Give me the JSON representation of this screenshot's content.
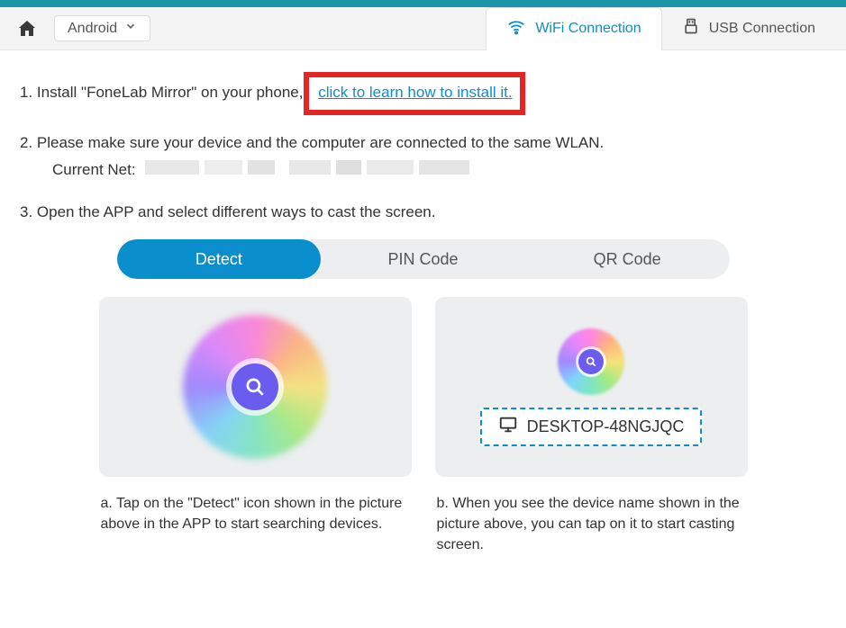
{
  "toolbar": {
    "platform": "Android"
  },
  "connection_tabs": {
    "wifi": "WiFi Connection",
    "usb": "USB Connection",
    "active": "wifi"
  },
  "steps": {
    "s1_prefix": "1. Install \"FoneLab Mirror\" on your phone,",
    "s1_link_label": "click to learn how to install it.",
    "s2": "2. Please make sure your device and the computer are connected to the same WLAN.",
    "s2_net_label": "Current Net:",
    "s2_net_value": "",
    "s3": "3. Open the APP and select different ways to cast the screen."
  },
  "method_tabs": {
    "detect": "Detect",
    "pin": "PIN Code",
    "qr": "QR Code",
    "active": "detect"
  },
  "panels": {
    "a_caption": "a. Tap on the \"Detect\" icon shown in the picture above in the APP to start searching devices.",
    "b_caption": "b. When you see the device name shown in the picture above, you can tap on it to start casting screen.",
    "device_name": "DESKTOP-48NGJQC"
  }
}
